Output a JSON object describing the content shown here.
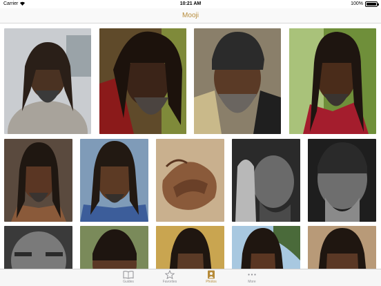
{
  "status_bar": {
    "carrier": "Carrier",
    "time": "10:21 AM",
    "battery_percent": "100%",
    "battery_level": 1.0
  },
  "nav": {
    "title": "Mooji"
  },
  "colors": {
    "accent": "#b68b3a",
    "inactive": "#8e8e93"
  },
  "tabs": [
    {
      "label": "Guides",
      "icon": "book-icon",
      "active": false
    },
    {
      "label": "Favorites",
      "icon": "star-icon",
      "active": false
    },
    {
      "label": "Photos",
      "icon": "portrait-icon",
      "active": true
    },
    {
      "label": "More",
      "icon": "more-dots-icon",
      "active": false
    }
  ]
}
